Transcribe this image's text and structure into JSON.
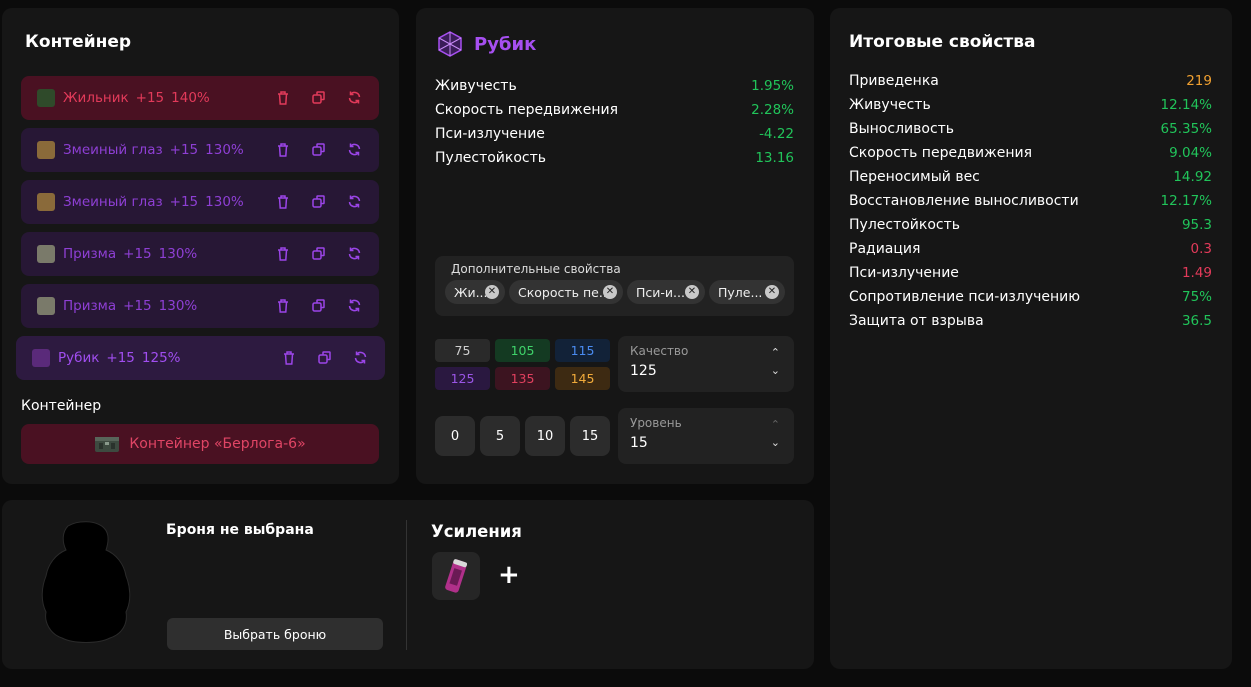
{
  "container_panel": {
    "title": "Контейнер",
    "artifacts": [
      {
        "name": "Жильник",
        "level": "+15",
        "quality": "140%",
        "style": "red"
      },
      {
        "name": "Змеиный глаз",
        "level": "+15",
        "quality": "130%",
        "style": "purple"
      },
      {
        "name": "Змеиный глаз",
        "level": "+15",
        "quality": "130%",
        "style": "purple"
      },
      {
        "name": "Призма",
        "level": "+15",
        "quality": "130%",
        "style": "purple"
      },
      {
        "name": "Призма",
        "level": "+15",
        "quality": "130%",
        "style": "purple"
      },
      {
        "name": "Рубик",
        "level": "+15",
        "quality": "125%",
        "style": "active"
      }
    ],
    "container_label": "Контейнер",
    "container_button": "Контейнер «Берлога-6»"
  },
  "artifact_panel": {
    "name": "Рубик",
    "stats": [
      {
        "label": "Живучесть",
        "value": "1.95%"
      },
      {
        "label": "Скорость передвижения",
        "value": "2.28%"
      },
      {
        "label": "Пси-излучение",
        "value": "-4.22"
      },
      {
        "label": "Пулестойкость",
        "value": "13.16"
      }
    ],
    "extras_label": "Дополнительные свойства",
    "extras_chips": [
      "Жи...",
      "Скорость пе...",
      "Пси-и...",
      "Пуле..."
    ],
    "quality_options": [
      {
        "value": "75",
        "bg": "#2a2a2a",
        "fg": "#cfcfcf"
      },
      {
        "value": "105",
        "bg": "#143a22",
        "fg": "#3fd26a"
      },
      {
        "value": "115",
        "bg": "#122238",
        "fg": "#4a8bf0"
      },
      {
        "value": "125",
        "bg": "#2a1840",
        "fg": "#9a55e6"
      },
      {
        "value": "135",
        "bg": "#3c1420",
        "fg": "#e0405e"
      },
      {
        "value": "145",
        "bg": "#3d2a12",
        "fg": "#f0aa3a"
      }
    ],
    "quality_select": {
      "label": "Качество",
      "value": "125"
    },
    "level_options": [
      "0",
      "5",
      "10",
      "15"
    ],
    "level_select": {
      "label": "Уровень",
      "value": "15"
    }
  },
  "summary_panel": {
    "title": "Итоговые свойства",
    "stats": [
      {
        "label": "Приведенка",
        "value": "219",
        "color": "orange"
      },
      {
        "label": "Живучесть",
        "value": "12.14%",
        "color": "green"
      },
      {
        "label": "Выносливость",
        "value": "65.35%",
        "color": "green"
      },
      {
        "label": "Скорость передвижения",
        "value": "9.04%",
        "color": "green"
      },
      {
        "label": "Переносимый вес",
        "value": "14.92",
        "color": "green"
      },
      {
        "label": "Восстановление выносливости",
        "value": "12.17%",
        "color": "green"
      },
      {
        "label": "Пулестойкость",
        "value": "95.3",
        "color": "green"
      },
      {
        "label": "Радиация",
        "value": "0.3",
        "color": "pink"
      },
      {
        "label": "Пси-излучение",
        "value": "1.49",
        "color": "pink"
      },
      {
        "label": "Сопротивление пси-излучению",
        "value": "75%",
        "color": "green"
      },
      {
        "label": "Защита от взрыва",
        "value": "36.5",
        "color": "green"
      }
    ]
  },
  "armor_panel": {
    "title": "Броня не выбрана",
    "select_button": "Выбрать броню",
    "boosts_title": "Усиления",
    "add_symbol": "+"
  }
}
